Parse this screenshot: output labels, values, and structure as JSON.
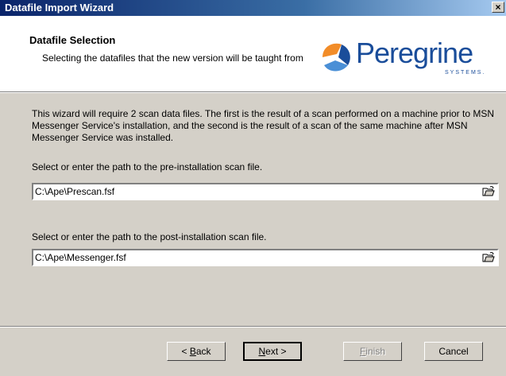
{
  "window": {
    "title": "Datafile Import Wizard",
    "close_label": "×"
  },
  "header": {
    "title": "Datafile Selection",
    "subtitle": "Selecting the datafiles that the new version will be taught from",
    "logo_text": "Peregrine",
    "logo_sub": "SYSTEMS."
  },
  "body": {
    "description": "This wizard will require 2 scan data files.  The first is the result of a scan performed on a machine prior to MSN Messenger Service's installation, and the second is the result of a scan of the same machine after MSN Messenger Service was installed.",
    "pre_label": "Select or enter the path to the pre-installation scan file.",
    "pre_value": "C:\\Ape\\Prescan.fsf",
    "post_label": "Select or enter the path to the post-installation scan file.",
    "post_value": "C:\\Ape\\Messenger.fsf"
  },
  "buttons": {
    "back_prefix": "< ",
    "back_key": "B",
    "back_rest": "ack",
    "next_key": "N",
    "next_rest": "ext >",
    "finish_key": "F",
    "finish_rest": "inish",
    "cancel": "Cancel"
  },
  "colors": {
    "titlebar": "#0a246a",
    "logo": "#1a4d9a",
    "dialog_bg": "#d4d0c8"
  }
}
